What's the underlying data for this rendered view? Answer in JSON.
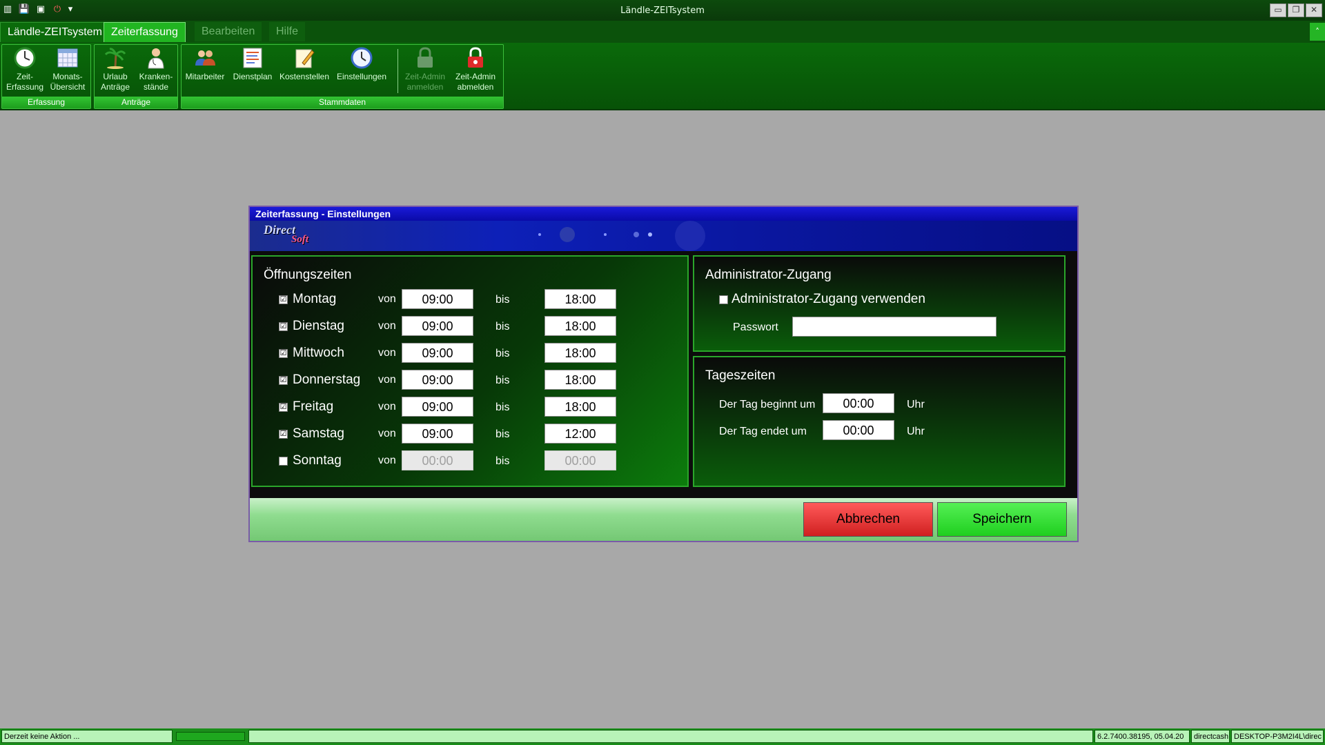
{
  "window": {
    "title": "Ländle-ZEITsystem"
  },
  "tabs": {
    "app": "Ländle-ZEITsystem",
    "zeiterfassung": "Zeiterfassung",
    "bearbeiten": "Bearbeiten",
    "hilfe": "Hilfe"
  },
  "ribbon": {
    "groups": {
      "erfassung": "Erfassung",
      "antraege": "Anträge",
      "stammdaten": "Stammdaten"
    },
    "buttons": {
      "zeit": "Zeit-\nErfassung",
      "monat": "Monats-\nÜbersicht",
      "urlaub": "Urlaub\nAnträge",
      "krank": "Kranken-\nstände",
      "mitarbeiter": "Mitarbeiter",
      "dienstplan": "Dienstplan",
      "kostenstellen": "Kostenstellen",
      "einstellungen": "Einstellungen",
      "admin_in": "Zeit-Admin\nanmelden",
      "admin_out": "Zeit-Admin\nabmelden"
    }
  },
  "dialog": {
    "title": "Zeiterfassung - Einstellungen",
    "logo_main": "Direct",
    "logo_sub": "Soft",
    "opening": {
      "title": "Öffnungszeiten",
      "von_label": "von",
      "bis_label": "bis",
      "days": [
        {
          "name": "Montag",
          "checked": "☑",
          "von": "09:00",
          "bis": "18:00"
        },
        {
          "name": "Dienstag",
          "checked": "☑",
          "von": "09:00",
          "bis": "18:00"
        },
        {
          "name": "Mittwoch",
          "checked": "☑",
          "von": "09:00",
          "bis": "18:00"
        },
        {
          "name": "Donnerstag",
          "checked": "☑",
          "von": "09:00",
          "bis": "18:00"
        },
        {
          "name": "Freitag",
          "checked": "☑",
          "von": "09:00",
          "bis": "18:00"
        },
        {
          "name": "Samstag",
          "checked": "☑",
          "von": "09:00",
          "bis": "12:00"
        },
        {
          "name": "Sonntag",
          "checked": "",
          "von": "00:00",
          "bis": "00:00"
        }
      ]
    },
    "admin": {
      "title": "Administrator-Zugang",
      "checkbox_label": "Administrator-Zugang verwenden",
      "password_label": "Passwort",
      "password_value": ""
    },
    "tageszeiten": {
      "title": "Tageszeiten",
      "start_label": "Der Tag beginnt um",
      "start_value": "00:00",
      "end_label": "Der Tag endet um",
      "end_value": "00:00",
      "unit": "Uhr"
    },
    "buttons": {
      "cancel": "Abbrechen",
      "save": "Speichern"
    }
  },
  "statusbar": {
    "action": "Derzeit keine Aktion ...",
    "progress_fraction": 1.0,
    "version": "6.2.7400.38195, 05.04.20",
    "user": "directcash",
    "machine": "DESKTOP-P3M2I4L\\direc"
  },
  "colors": {
    "title_bg": "#0a3a0a",
    "ribbon_bg": "#0a6a0a",
    "accent_tab": "#21b521",
    "dialog_title": "#1a1ad8",
    "cancel": "#e03030",
    "save": "#2fdc2f"
  },
  "icons": {
    "qat": [
      "app-icon",
      "save-icon",
      "save-all-icon",
      "power-icon",
      "dropdown-icon"
    ]
  }
}
